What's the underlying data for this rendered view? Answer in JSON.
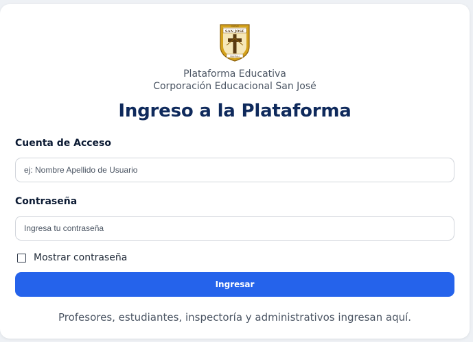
{
  "header": {
    "logo": {
      "icon": "school-crest-logo",
      "text_top": "COLEGIO",
      "text_main": "SAN JOSÉ",
      "text_bottom": "MACHALI",
      "colors": {
        "gold": "#d4a21c",
        "cream": "#f6e7b8",
        "brown": "#5a3a10"
      }
    },
    "subtitle_line1": "Plataforma Educativa",
    "subtitle_line2": "Corporación Educacional San José",
    "title": "Ingreso a la Plataforma"
  },
  "form": {
    "username": {
      "label": "Cuenta de Acceso",
      "placeholder": "ej: Nombre Apellido de Usuario",
      "value": ""
    },
    "password": {
      "label": "Contraseña",
      "placeholder": "Ingresa tu contraseña",
      "value": ""
    },
    "show_password": {
      "label": "Mostrar contraseña",
      "checked": false
    },
    "submit_label": "Ingresar"
  },
  "footer": {
    "note": "Profesores, estudiantes, inspectoría y administrativos ingresan aquí."
  },
  "colors": {
    "primary": "#2563eb",
    "title": "#0f2a5c",
    "page_background": "#eef1f5"
  }
}
